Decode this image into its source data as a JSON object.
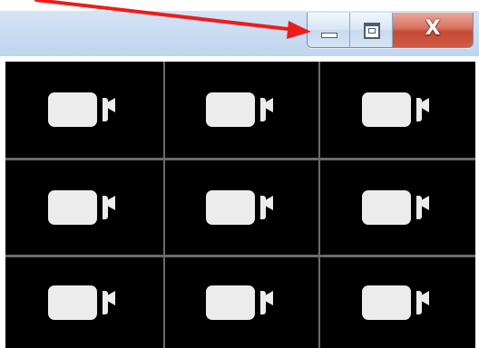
{
  "window": {
    "controls": {
      "minimize": {
        "icon": "minimize-icon"
      },
      "maximize": {
        "icon": "maximize-icon"
      },
      "close": {
        "label": "X",
        "icon": "close-icon",
        "color": "#c44a34"
      }
    }
  },
  "video_grid": {
    "tiles": [
      {
        "icon": "video-camera-icon"
      },
      {
        "icon": "video-camera-icon"
      },
      {
        "icon": "video-camera-icon"
      },
      {
        "icon": "video-camera-icon"
      },
      {
        "icon": "video-camera-icon"
      },
      {
        "icon": "video-camera-icon"
      },
      {
        "icon": "video-camera-icon"
      },
      {
        "icon": "video-camera-icon"
      },
      {
        "icon": "video-camera-icon"
      }
    ],
    "tile_color": "#000000",
    "icon_color": "#ececec"
  },
  "annotation": {
    "arrow_color": "#ee1c1c",
    "target": "minimize-button"
  }
}
